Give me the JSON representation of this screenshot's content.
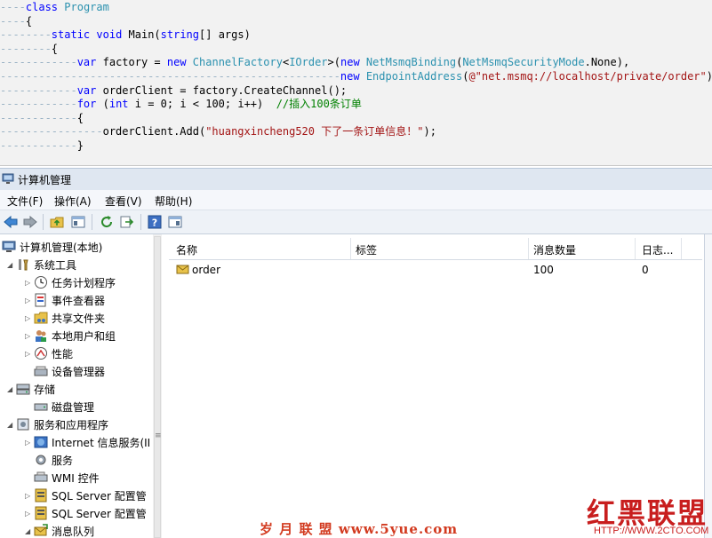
{
  "code": {
    "lines": [
      {
        "dots": "----",
        "parts": [
          {
            "c": "kw",
            "t": "class"
          },
          {
            "c": "pl",
            "t": " "
          },
          {
            "c": "ty",
            "t": "Program"
          }
        ]
      },
      {
        "dots": "----",
        "parts": [
          {
            "c": "pl",
            "t": "{"
          }
        ]
      },
      {
        "dots": "--------",
        "parts": [
          {
            "c": "kw",
            "t": "static"
          },
          {
            "c": "pl",
            "t": " "
          },
          {
            "c": "kw",
            "t": "void"
          },
          {
            "c": "pl",
            "t": " Main("
          },
          {
            "c": "kw",
            "t": "string"
          },
          {
            "c": "pl",
            "t": "[] args)"
          }
        ]
      },
      {
        "dots": "--------",
        "parts": [
          {
            "c": "pl",
            "t": "{"
          }
        ]
      },
      {
        "dots": "------------",
        "parts": [
          {
            "c": "kw",
            "t": "var"
          },
          {
            "c": "pl",
            "t": " factory = "
          },
          {
            "c": "kw",
            "t": "new"
          },
          {
            "c": "pl",
            "t": " "
          },
          {
            "c": "ty",
            "t": "ChannelFactory"
          },
          {
            "c": "pl",
            "t": "<"
          },
          {
            "c": "ty",
            "t": "IOrder"
          },
          {
            "c": "pl",
            "t": ">("
          },
          {
            "c": "kw",
            "t": "new"
          },
          {
            "c": "pl",
            "t": " "
          },
          {
            "c": "ty",
            "t": "NetMsmqBinding"
          },
          {
            "c": "pl",
            "t": "("
          },
          {
            "c": "ty",
            "t": "NetMsmqSecurityMode"
          },
          {
            "c": "pl",
            "t": ".None),"
          }
        ]
      },
      {
        "dots": "-----------------------------------------------------",
        "parts": [
          {
            "c": "kw",
            "t": "new"
          },
          {
            "c": "pl",
            "t": " "
          },
          {
            "c": "ty",
            "t": "EndpointAddress"
          },
          {
            "c": "pl",
            "t": "("
          },
          {
            "c": "str",
            "t": "@\"net.msmq://localhost/private/order\""
          },
          {
            "c": "pl",
            "t": "));"
          }
        ]
      },
      {
        "dots": "------------",
        "parts": [
          {
            "c": "kw",
            "t": "var"
          },
          {
            "c": "pl",
            "t": " orderClient = factory.CreateChannel();"
          }
        ]
      },
      {
        "dots": "------------",
        "parts": [
          {
            "c": "kw",
            "t": "for"
          },
          {
            "c": "pl",
            "t": " ("
          },
          {
            "c": "kw",
            "t": "int"
          },
          {
            "c": "pl",
            "t": " i = 0; i < 100; i++)  "
          },
          {
            "c": "cm",
            "t": "//插入100条订单"
          }
        ]
      },
      {
        "dots": "------------",
        "parts": [
          {
            "c": "pl",
            "t": "{"
          }
        ]
      },
      {
        "dots": "----------------",
        "parts": [
          {
            "c": "pl",
            "t": "orderClient.Add("
          },
          {
            "c": "str",
            "t": "\"huangxincheng520 下了一条订单信息！\""
          },
          {
            "c": "pl",
            "t": ");"
          }
        ]
      },
      {
        "dots": "------------",
        "parts": [
          {
            "c": "pl",
            "t": "}"
          }
        ]
      }
    ]
  },
  "window": {
    "title": "计算机管理"
  },
  "menu": {
    "file": "文件(F)",
    "action": "操作(A)",
    "view": "查看(V)",
    "help": "帮助(H)"
  },
  "tree": {
    "root": "计算机管理(本地)",
    "system_tools": "系统工具",
    "task_scheduler": "任务计划程序",
    "event_viewer": "事件查看器",
    "shared_folders": "共享文件夹",
    "local_users": "本地用户和组",
    "performance": "性能",
    "device_manager": "设备管理器",
    "storage": "存储",
    "disk_management": "磁盘管理",
    "services_apps": "服务和应用程序",
    "iis": "Internet 信息服务(II",
    "services": "服务",
    "wmi": "WMI 控件",
    "sql1": "SQL Server 配置管",
    "sql2": "SQL Server 配置管",
    "message_queuing": "消息队列"
  },
  "list": {
    "headers": {
      "name": "名称",
      "label": "标签",
      "msgcount": "消息数量",
      "journal": "日志..."
    },
    "rows": [
      {
        "name": "order",
        "label": "",
        "msgcount": "100",
        "journal": "0"
      }
    ]
  },
  "watermarks": {
    "site1": "岁 月 联 盟   www.5yue.com",
    "site2": "红黑联盟",
    "site2_url": "HTTP://WWW.2CTO.COM"
  }
}
